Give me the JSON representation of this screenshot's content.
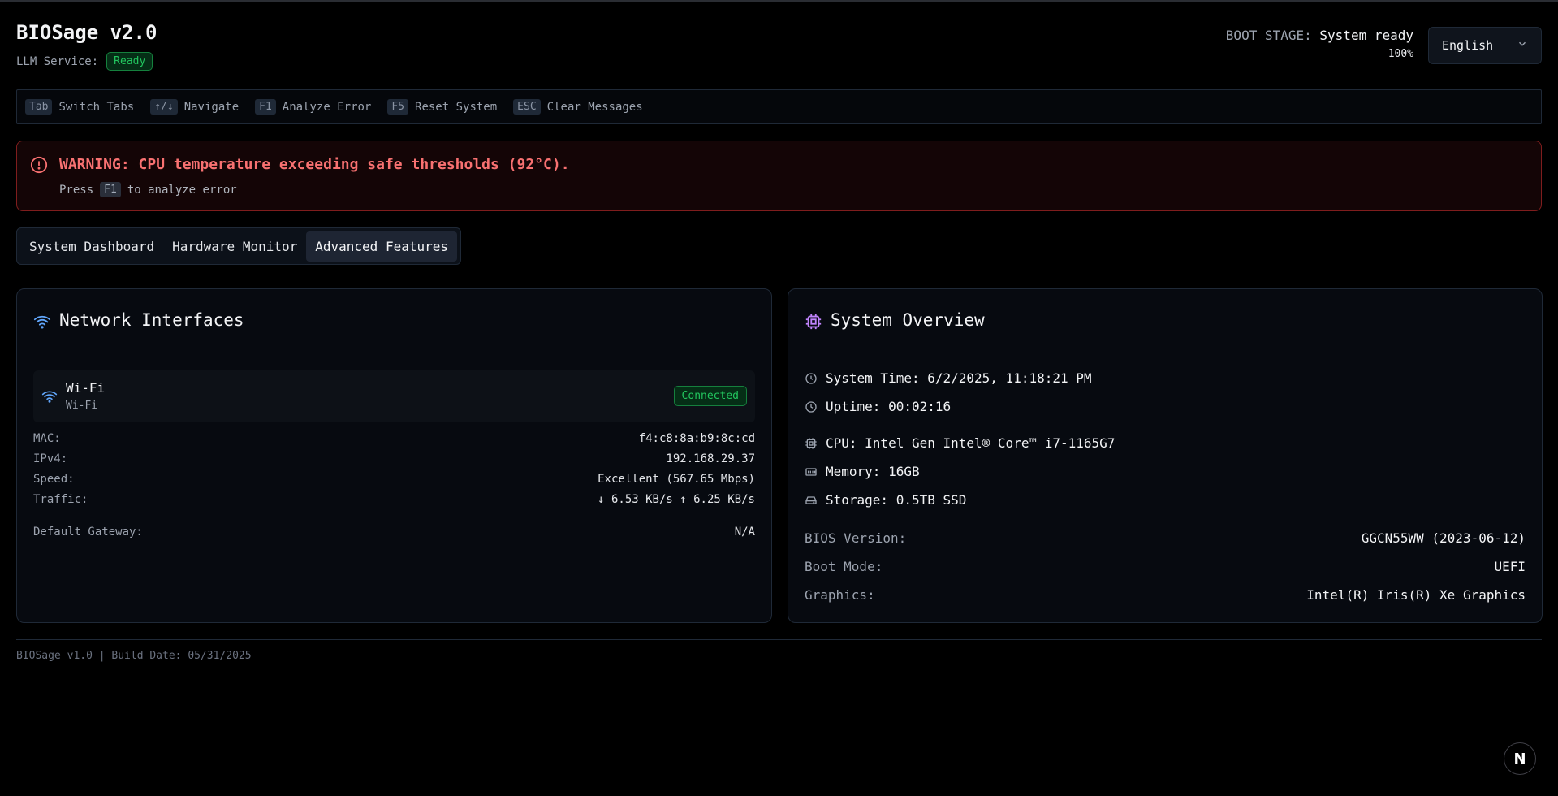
{
  "header": {
    "title": "BIOSage v2.0",
    "llm_label": "LLM Service:",
    "llm_status": "Ready",
    "boot_label": "BOOT STAGE:",
    "boot_value": "System ready",
    "boot_progress": "100%",
    "language": "English"
  },
  "shortcuts": [
    {
      "key": "Tab",
      "label": "Switch Tabs"
    },
    {
      "key": "↑/↓",
      "label": "Navigate"
    },
    {
      "key": "F1",
      "label": "Analyze Error"
    },
    {
      "key": "F5",
      "label": "Reset System"
    },
    {
      "key": "ESC",
      "label": "Clear Messages"
    }
  ],
  "warning": {
    "message": "WARNING: CPU temperature exceeding safe thresholds (92°C).",
    "press": "Press",
    "key": "F1",
    "action": "to analyze error"
  },
  "tabs": [
    {
      "label": "System Dashboard",
      "active": false
    },
    {
      "label": "Hardware Monitor",
      "active": false
    },
    {
      "label": "Advanced Features",
      "active": true
    }
  ],
  "network": {
    "title": "Network Interfaces",
    "interface_name": "Wi-Fi",
    "interface_type": "Wi-Fi",
    "status": "Connected",
    "details": [
      {
        "key": "MAC:",
        "value": "f4:c8:8a:b9:8c:cd"
      },
      {
        "key": "IPv4:",
        "value": "192.168.29.37"
      },
      {
        "key": "Speed:",
        "value": "Excellent (567.65 Mbps)"
      },
      {
        "key": "Traffic:",
        "value": "↓ 6.53 KB/s ↑ 6.25 KB/s"
      }
    ],
    "gateway_label": "Default Gateway:",
    "gateway_value": "N/A"
  },
  "overview": {
    "title": "System Overview",
    "system_time": "System Time: 6/2/2025, 11:18:21 PM",
    "uptime": "Uptime: 00:02:16",
    "cpu": "CPU: Intel Gen Intel® Core™ i7-1165G7",
    "memory": "Memory: 16GB",
    "storage": "Storage: 0.5TB SSD",
    "details": [
      {
        "key": "BIOS Version:",
        "value": "GGCN55WW (2023-06-12)"
      },
      {
        "key": "Boot Mode:",
        "value": "UEFI"
      },
      {
        "key": "Graphics:",
        "value": "Intel(R) Iris(R) Xe Graphics"
      }
    ]
  },
  "footer": {
    "text": "BIOSage v1.0 | Build Date: 05/31/2025",
    "badge": "N"
  },
  "colors": {
    "accent_green": "#22c55e",
    "warning_red": "#f87171",
    "wifi_blue": "#60a5fa",
    "cpu_purple": "#c084fc"
  }
}
